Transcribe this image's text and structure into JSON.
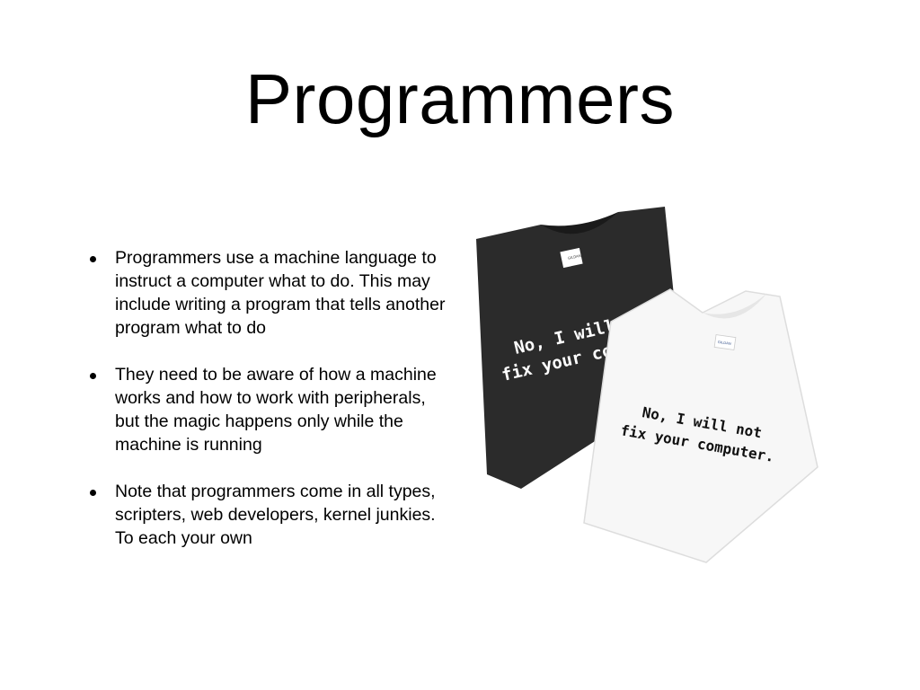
{
  "slide": {
    "title": "Programmers",
    "bullets": [
      "Programmers use a machine language to instruct a computer what to do. This may include writing a program that tells another program what to do",
      "They need to be aware of how a machine works and how to work with peripherals, but the magic happens only while the machine is running",
      "Note that programmers come in all types, scripters, web developers, kernel junkies. To each your own"
    ]
  },
  "image": {
    "black_shirt": {
      "line1": "No, I will no",
      "line2": "fix your compu",
      "color": "#2b2b2b"
    },
    "white_shirt": {
      "line1": "No, I will not",
      "line2": "fix your computer.",
      "color": "#f7f7f7"
    },
    "tag_label": "GILDAN"
  }
}
